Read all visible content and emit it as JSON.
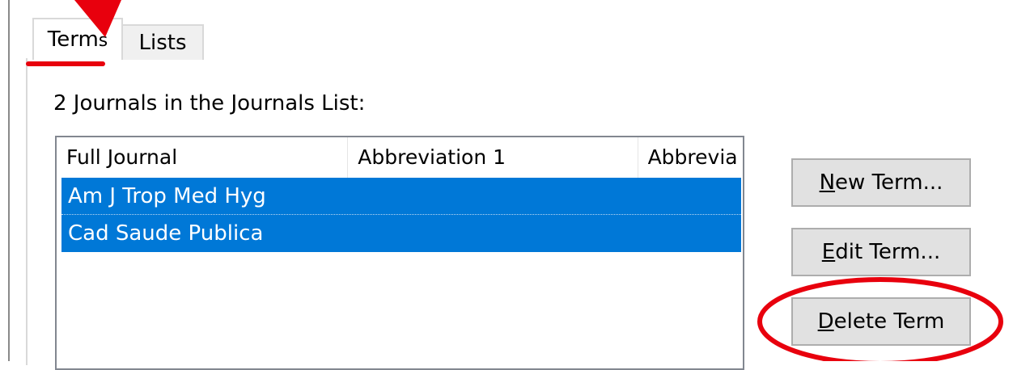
{
  "tabs": {
    "terms": {
      "prefix": "Term",
      "last": "s"
    },
    "lists": {
      "label": "Lists"
    }
  },
  "journals_count_label": "2 Journals in the Journals List:",
  "list": {
    "columns": [
      "Full Journal",
      "Abbreviation 1",
      "Abbrevia"
    ],
    "rows": [
      {
        "full_journal": "Am J Trop Med Hyg"
      },
      {
        "full_journal": "Cad Saude Publica"
      }
    ]
  },
  "buttons": {
    "new_term": {
      "mnemonic": "N",
      "rest": "ew Term..."
    },
    "edit_term": {
      "mnemonic": "E",
      "rest": "dit Term..."
    },
    "delete_term": {
      "mnemonic": "D",
      "rest": "elete Term"
    }
  },
  "annotations": {
    "accent_color": "#e8000d",
    "selection_color": "#0078d7"
  }
}
